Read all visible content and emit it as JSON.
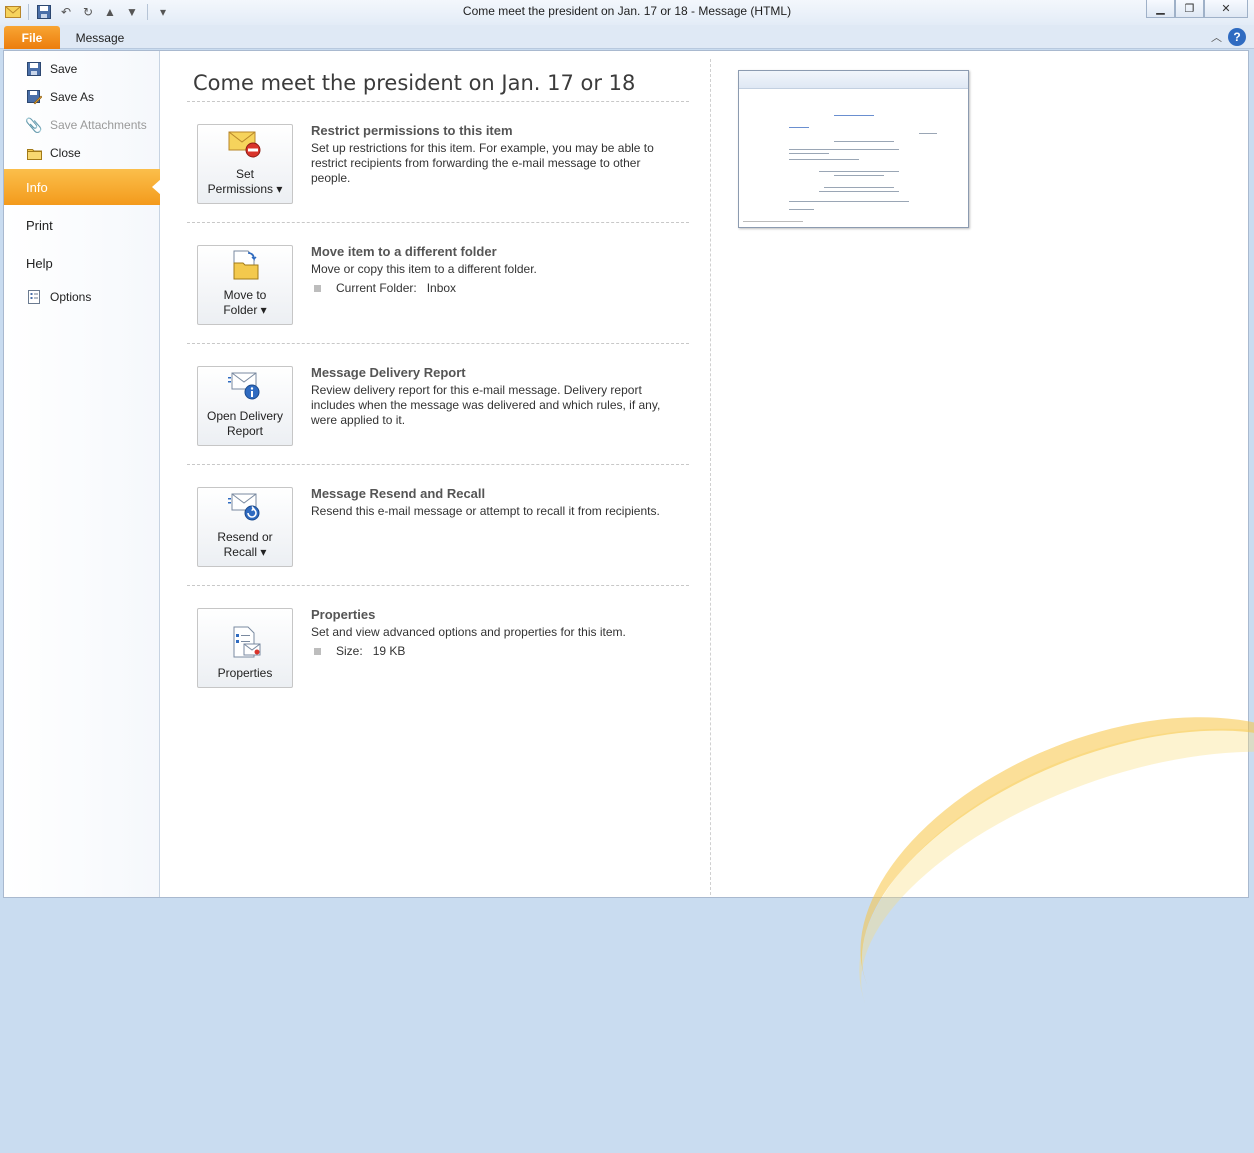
{
  "window": {
    "title": "Come meet the president on Jan. 17 or 18  -  Message (HTML)"
  },
  "tabs": {
    "file": "File",
    "message": "Message"
  },
  "nav": {
    "save": "Save",
    "save_as": "Save As",
    "save_attachments": "Save Attachments",
    "close": "Close",
    "info": "Info",
    "print": "Print",
    "help": "Help",
    "options": "Options"
  },
  "page_title": "Come meet the president on Jan. 17 or 18",
  "sections": [
    {
      "button_line1": "Set",
      "button_line2": "Permissions",
      "title": "Restrict permissions to this item",
      "description": "Set up restrictions for this item. For example, you may be able to restrict recipients from forwarding the e-mail message to other people."
    },
    {
      "button_line1": "Move to",
      "button_line2": "Folder",
      "title": "Move item to a different folder",
      "description": "Move or copy this item to a different folder.",
      "detail_label": "Current Folder:",
      "detail_value": "Inbox"
    },
    {
      "button_line1": "Open Delivery",
      "button_line2": "Report",
      "title": "Message Delivery Report",
      "description": "Review delivery report for this e-mail message. Delivery report includes when the message was delivered and which rules, if any, were applied to it."
    },
    {
      "button_line1": "Resend or",
      "button_line2": "Recall",
      "title": "Message Resend and Recall",
      "description": "Resend this e-mail message or attempt to recall it from recipients."
    },
    {
      "button_line1": "Properties",
      "title": "Properties",
      "description": "Set and view advanced options and properties for this item.",
      "detail_label": "Size:",
      "detail_value": "19 KB"
    }
  ],
  "colors": {
    "file_tab": "#ec7d0d",
    "active_nav": "#f39a1c"
  }
}
